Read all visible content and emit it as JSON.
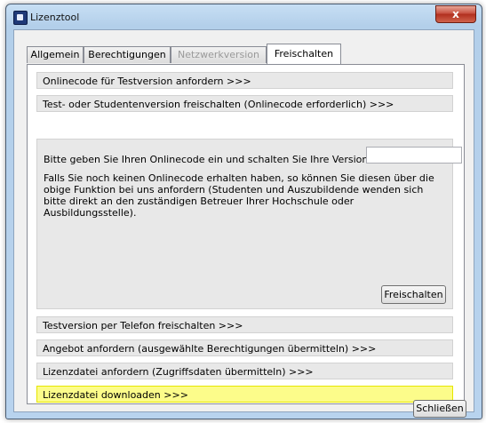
{
  "window": {
    "title": "Lizenztool",
    "close_glyph": "x"
  },
  "tabs": [
    {
      "label": "Allgemein",
      "state": "normal"
    },
    {
      "label": "Berechtigungen",
      "state": "normal"
    },
    {
      "label": "Netzwerkversion",
      "state": "disabled"
    },
    {
      "label": "Freischalten",
      "state": "active"
    }
  ],
  "sections": {
    "online_code": "Onlinecode für Testversion anfordern >>>",
    "test_student": "Test- oder Studentenversion freischalten (Onlinecode erforderlich) >>>",
    "telefon": "Testversion per Telefon freischalten >>>",
    "angebot": "Angebot anfordern (ausgewählte Berechtigungen übermitteln) >>>",
    "lizenzdatei_anfordern": "Lizenzdatei anfordern (Zugriffsdaten übermitteln) >>>",
    "lizenzdatei_download": "Lizenzdatei downloaden >>>"
  },
  "unlock_panel": {
    "prompt": "Bitte geben Sie Ihren Onlinecode ein und schalten Sie Ihre Version frei",
    "code_value": "",
    "info": "Falls Sie noch keinen Onlinecode erhalten haben, so können Sie diesen über die obige Funktion bei uns anfordern (Studenten und Auszubildende wenden sich bitte direkt an den zuständigen Betreuer Ihrer Hochschule oder Ausbildungsstelle).",
    "unlock_button": "Freischalten"
  },
  "footer": {
    "close_button": "Schließen"
  },
  "colors": {
    "highlight": "#fcfc8a",
    "close_red": "#c75040"
  }
}
